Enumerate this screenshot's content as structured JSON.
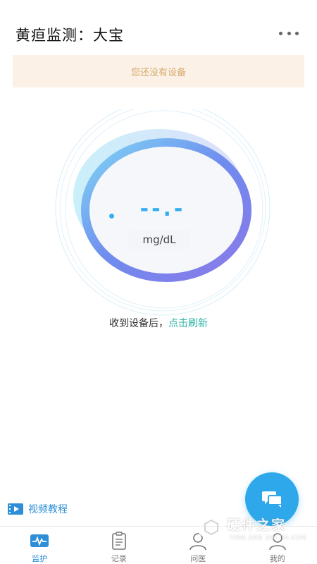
{
  "header": {
    "title": "黄疸监测：大宝",
    "more_icon": "more-dots-icon"
  },
  "notice": {
    "text": "您还没有设备"
  },
  "gauge": {
    "reading": "--.-",
    "unit": "mg/dL"
  },
  "hint": {
    "prefix": "收到设备后，",
    "link": "点击刷新"
  },
  "tutorial": {
    "label": "视频教程",
    "icon": "video-icon"
  },
  "fab": {
    "icon": "chat-icon"
  },
  "tabs": [
    {
      "label": "监护",
      "icon": "monitor-icon",
      "active": true
    },
    {
      "label": "记录",
      "icon": "clipboard-icon",
      "active": false
    },
    {
      "label": "问医",
      "icon": "doctor-icon",
      "active": false
    },
    {
      "label": "我的",
      "icon": "person-icon",
      "active": false
    }
  ],
  "watermark": {
    "text": "硬件之家",
    "sub": "YING JIAN ZHI JIA.COM"
  },
  "colors": {
    "accent": "#2ea8ea",
    "link": "#2cb3a6",
    "notice_bg": "#fbf1e6",
    "notice_text": "#d6a86a"
  }
}
